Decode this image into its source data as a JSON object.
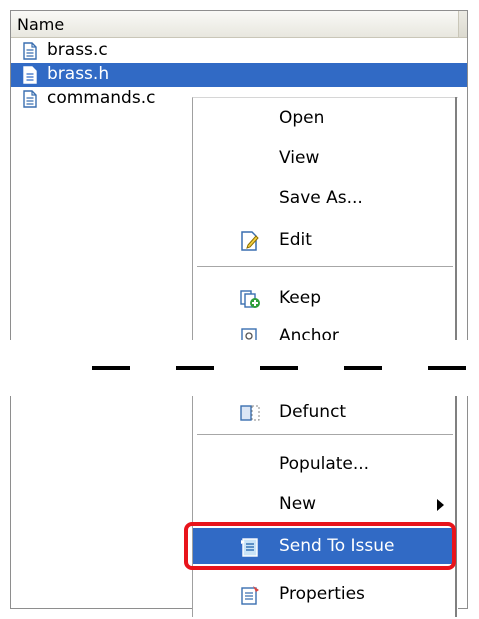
{
  "file_list": {
    "column_header": "Name",
    "files": [
      {
        "name": "brass.c",
        "selected": false
      },
      {
        "name": "brass.h",
        "selected": true
      },
      {
        "name": "commands.c",
        "selected": false
      }
    ]
  },
  "context_menu": {
    "items": {
      "open": "Open",
      "view": "View",
      "save_as": "Save As...",
      "edit": "Edit",
      "keep": "Keep",
      "anchor": "Anchor",
      "defunct": "Defunct",
      "populate": "Populate...",
      "new": "New",
      "send_to_issue": "Send To Issue",
      "properties": "Properties"
    },
    "highlighted_item": "Send To Issue"
  },
  "colors": {
    "selection": "#316ac5",
    "callout": "#e8141b"
  },
  "icons": [
    "document-icon",
    "edit-icon",
    "keep-icon",
    "anchor-icon",
    "defunct-icon",
    "send-to-issue-icon",
    "properties-icon",
    "submenu-arrow-icon"
  ]
}
